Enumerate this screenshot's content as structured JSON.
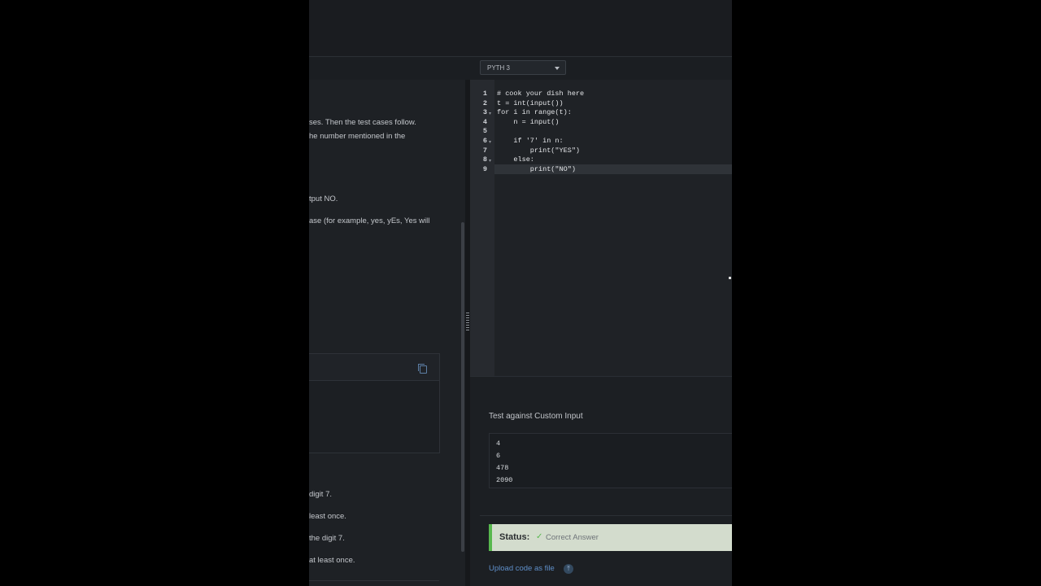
{
  "toolbar": {
    "language": "PYTH 3"
  },
  "problem": {
    "lines": [
      "ses. Then the test cases follow.",
      "he number mentioned in the",
      "tput NO.",
      "ase (for example, yes, yEs, Yes will",
      "digit 7.",
      "least once.",
      "the digit 7.",
      "at least once."
    ]
  },
  "editor": {
    "line_numbers": [
      "1",
      "2",
      "3",
      "4",
      "5",
      "6",
      "7",
      "8",
      "9"
    ],
    "code_lines": [
      "# cook your dish here",
      "t = int(input())",
      "for i in range(t):",
      "    n = input()",
      "",
      "    if '7' in n:",
      "        print(\"YES\")",
      "    else:",
      "        print(\"NO\")"
    ]
  },
  "custom_input": {
    "title": "Test against Custom Input",
    "values": [
      "4",
      "6",
      "478",
      "2090"
    ]
  },
  "status": {
    "label": "Status:",
    "value": "Correct Answer",
    "color": "#58b84e"
  },
  "upload": {
    "label": "Upload code as file"
  }
}
